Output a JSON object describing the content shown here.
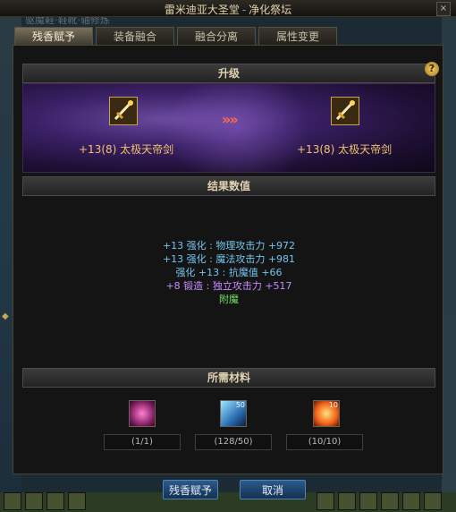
{
  "window": {
    "title_location": "雷米迪亚大圣堂",
    "title_separator": "-",
    "title_place": "净化祭坛",
    "close_glyph": "×",
    "background_text": "驱魔鞋·鞋靴·轴修炼"
  },
  "tabs": [
    {
      "label": "残香赋予",
      "active": true
    },
    {
      "label": "装备融合",
      "active": false
    },
    {
      "label": "融合分离",
      "active": false
    },
    {
      "label": "属性变更",
      "active": false
    }
  ],
  "panel": {
    "help_glyph": "?",
    "upgrade_header": "升级",
    "results_header": "结果数值",
    "materials_header": "所需材料"
  },
  "upgrade": {
    "arrows": "»»",
    "before": {
      "label": "+13(8) 太极天帝剑",
      "icon": "sword-icon"
    },
    "after": {
      "label": "+13(8) 太极天帝剑",
      "icon": "sword-icon"
    }
  },
  "results": {
    "line1": "+13 强化 : 物理攻击力 +972",
    "line2": "+13 强化 : 魔法攻击力 +981",
    "line3": "强化 +13 : 抗魔值 +66",
    "line4": "+8 锻造 : 独立攻击力 +517",
    "line5": "附魔"
  },
  "materials": [
    {
      "icon": "pink-orb-icon",
      "badge": "",
      "qty": "(1/1)"
    },
    {
      "icon": "crystal-icon",
      "badge": "50",
      "qty": "(128/50)"
    },
    {
      "icon": "flame-orb-icon",
      "badge": "10",
      "qty": "(10/10)"
    }
  ],
  "buttons": {
    "confirm": "残香赋予",
    "cancel": "取消"
  },
  "colors": {
    "accent_blue": "#73c4ee",
    "accent_purple": "#c58cff",
    "accent_green": "#6fe266",
    "item_gold": "#f2c26b"
  }
}
